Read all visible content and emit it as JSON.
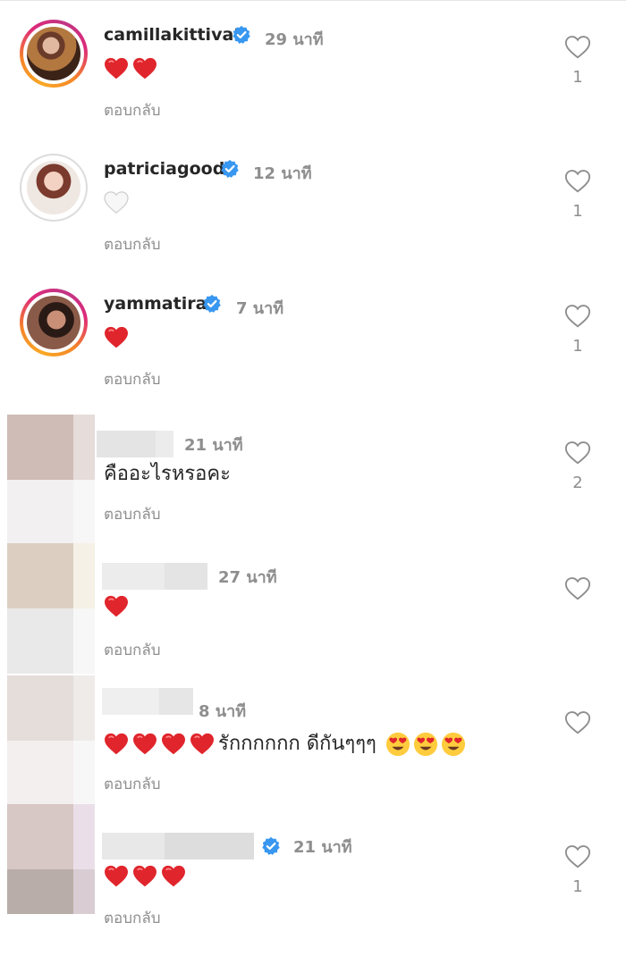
{
  "colors": {
    "accent_verified": "#3897f0",
    "heart_red": "#e0252c",
    "text_primary": "#262626",
    "text_secondary": "#8e8e8e"
  },
  "reply_label": "ตอบกลับ",
  "comments": [
    {
      "username": "camillakittivat",
      "verified": true,
      "time": "29 นาที",
      "text": "",
      "emoji": "red-heart x2",
      "likes": "1",
      "avatar": "story-ring photo"
    },
    {
      "username": "patriciagood",
      "verified": true,
      "time": "12 นาที",
      "text": "",
      "emoji": "white-heart",
      "likes": "1",
      "avatar": "grey-ring photo"
    },
    {
      "username": "yammatira",
      "verified": true,
      "time": "7 นาที",
      "text": "",
      "emoji": "red-heart",
      "likes": "1",
      "avatar": "story-ring photo"
    },
    {
      "username": "",
      "verified": false,
      "time": "21 นาที",
      "text": "คืออะไรหรอคะ",
      "emoji": "",
      "likes": "2",
      "avatar": "blurred"
    },
    {
      "username": "",
      "verified": false,
      "time": "27 นาที",
      "text": "",
      "emoji": "red-heart",
      "likes": "",
      "avatar": "blurred"
    },
    {
      "username": "",
      "verified": false,
      "time": "8 นาที",
      "text": "รักกกกกก ดีกันๆๆๆ",
      "emoji": "red-heart x4, heart-eyes x3",
      "likes": "",
      "avatar": "blurred"
    },
    {
      "username": "",
      "verified": true,
      "time": "21 นาที",
      "text": "",
      "emoji": "red-heart x3",
      "likes": "1",
      "avatar": "blurred"
    }
  ],
  "icons": {
    "like": "heart-outline-icon",
    "verified": "verified-badge-icon"
  }
}
